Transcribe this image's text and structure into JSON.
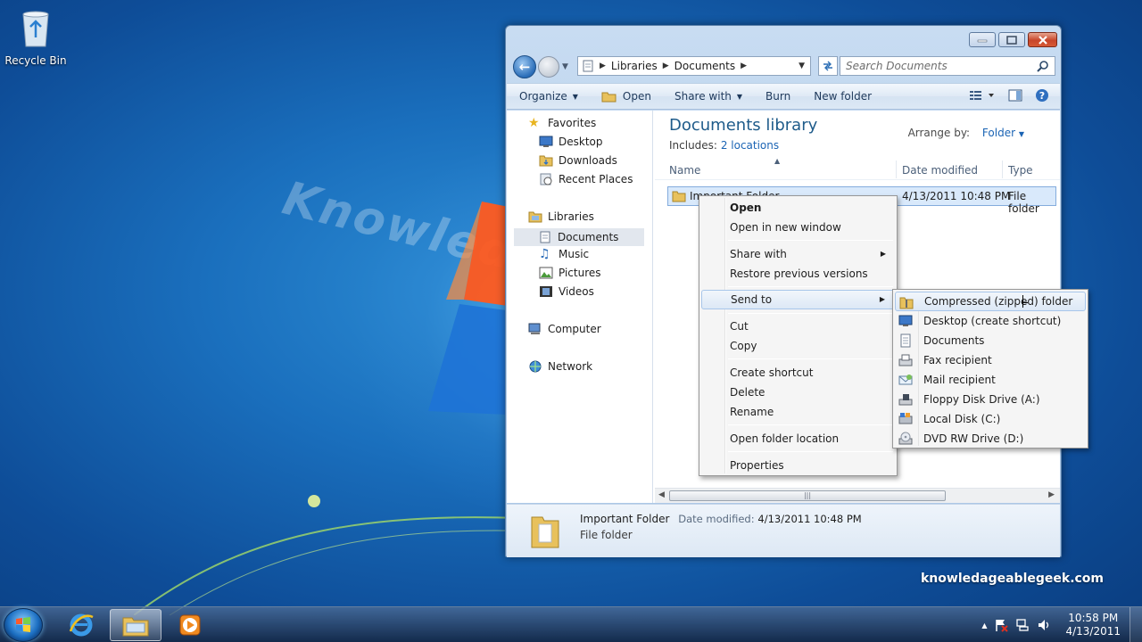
{
  "desktop": {
    "recycle_bin_label": "Recycle Bin",
    "brand_text": "knowledageablegeek.com",
    "watermark_text": "Knowledg"
  },
  "window": {
    "address": {
      "crumbs": [
        "Libraries",
        "Documents"
      ]
    },
    "search_placeholder": "Search Documents",
    "toolbar": {
      "organize": "Organize",
      "open": "Open",
      "share_with": "Share with",
      "burn": "Burn",
      "new_folder": "New folder"
    },
    "nav": {
      "favorites": "Favorites",
      "desktop": "Desktop",
      "downloads": "Downloads",
      "recent_places": "Recent Places",
      "libraries": "Libraries",
      "documents": "Documents",
      "music": "Music",
      "pictures": "Pictures",
      "videos": "Videos",
      "computer": "Computer",
      "network": "Network"
    },
    "library": {
      "title": "Documents library",
      "includes_label": "Includes:",
      "includes_link": "2 locations",
      "arrange_label": "Arrange by:",
      "arrange_value": "Folder"
    },
    "columns": {
      "name": "Name",
      "date_modified": "Date modified",
      "type": "Type"
    },
    "files": [
      {
        "name": "Important Folder",
        "date": "4/13/2011 10:48 PM",
        "type": "File folder"
      }
    ],
    "details": {
      "name": "Important Folder",
      "date_label": "Date modified:",
      "date_value": "4/13/2011 10:48 PM",
      "type": "File folder"
    }
  },
  "context_menu": {
    "open": "Open",
    "open_new_window": "Open in new window",
    "share_with": "Share with",
    "restore_previous": "Restore previous versions",
    "send_to": "Send to",
    "cut": "Cut",
    "copy": "Copy",
    "create_shortcut": "Create shortcut",
    "delete": "Delete",
    "rename": "Rename",
    "open_folder_location": "Open folder location",
    "properties": "Properties"
  },
  "send_to_menu": [
    {
      "label": "Compressed (zipped) folder",
      "icon": "zip-folder-icon"
    },
    {
      "label": "Desktop (create shortcut)",
      "icon": "desktop-icon"
    },
    {
      "label": "Documents",
      "icon": "document-icon"
    },
    {
      "label": "Fax recipient",
      "icon": "fax-icon"
    },
    {
      "label": "Mail recipient",
      "icon": "mail-icon"
    },
    {
      "label": "Floppy Disk Drive (A:)",
      "icon": "floppy-drive-icon"
    },
    {
      "label": "Local Disk (C:)",
      "icon": "hard-disk-icon"
    },
    {
      "label": "DVD RW Drive (D:)",
      "icon": "dvd-drive-icon"
    }
  ],
  "taskbar": {
    "clock_time": "10:58 PM",
    "clock_date": "4/13/2011"
  },
  "colors": {
    "accent": "#1b64b4",
    "selection": "#d9e9fb",
    "title_text": "#1e5b8a"
  }
}
